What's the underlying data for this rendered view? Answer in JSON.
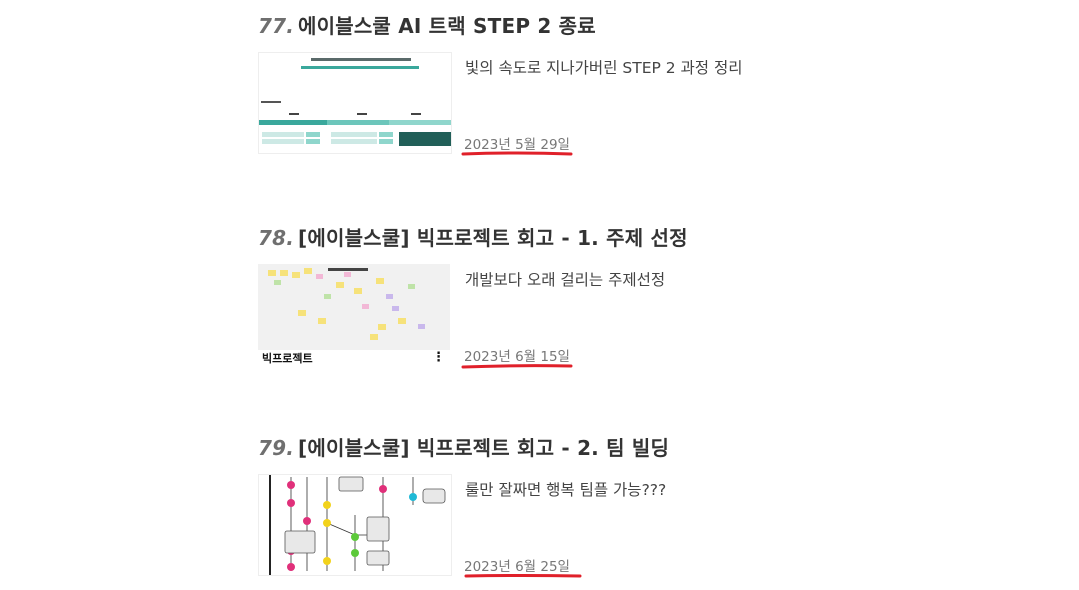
{
  "posts": [
    {
      "number": "77.",
      "title": "에이블스쿨 AI 트랙 STEP 2 종료",
      "description": "빛의 속도로 지나가버린 STEP 2 과정 정리",
      "date": "2023년 5월 29일",
      "thumb_icon": "slide-table-thumbnail"
    },
    {
      "number": "78.",
      "title": "[에이블스쿨] 빅프로젝트 회고 - 1. 주제 선정",
      "description": "개발보다 오래 걸리는 주제선정",
      "date": "2023년 6월 15일",
      "thumb_icon": "sticky-note-board-thumbnail",
      "thumb_caption": "빅프로젝트",
      "thumb_menu": "⋮"
    },
    {
      "number": "79.",
      "title": "[에이블스쿨] 빅프로젝트 회고 - 2. 팀 빌딩",
      "description": "룰만 잘짜면 행복 팀플 가능???",
      "date": "2023년 6월 25일",
      "thumb_icon": "flowchart-thumbnail"
    }
  ],
  "colors": {
    "underline": "#e0202a",
    "title_number": "#6f6f6f",
    "teal": "#3aa89c"
  }
}
